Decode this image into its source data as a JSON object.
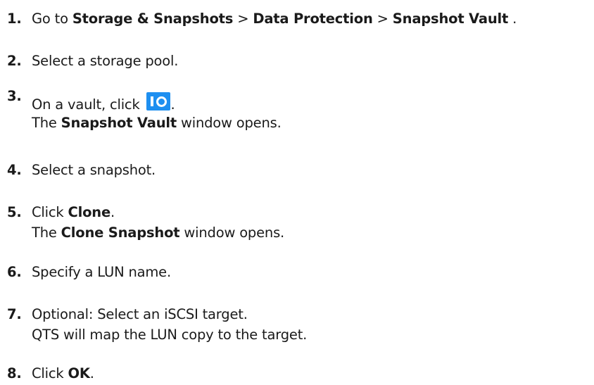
{
  "steps": [
    {
      "number": "1.",
      "parts": [
        "Go to ",
        "Storage & Snapshots",
        " > ",
        "Data Protection",
        " > ",
        "Snapshot Vault",
        " ."
      ]
    },
    {
      "number": "2.",
      "text": "Select a storage pool."
    },
    {
      "number": "3.",
      "line1_before": "On a vault, click ",
      "line1_after": ".",
      "icon": "snapshot-vault-icon",
      "line2_before": "The ",
      "line2_bold": "Snapshot Vault",
      "line2_after": " window opens."
    },
    {
      "number": "4.",
      "text": "Select a snapshot."
    },
    {
      "number": "5.",
      "line1_before": "Click ",
      "line1_bold": "Clone",
      "line1_after": ".",
      "line2_before": "The ",
      "line2_bold": "Clone Snapshot",
      "line2_after": " window opens."
    },
    {
      "number": "6.",
      "text": "Specify a LUN name."
    },
    {
      "number": "7.",
      "line1": "Optional: Select an iSCSI target.",
      "line2": "QTS will map the LUN copy to the target."
    },
    {
      "number": "8.",
      "line1_before": "Click ",
      "line1_bold": "OK",
      "line1_after": "."
    }
  ],
  "colors": {
    "text": "#1a1a1a",
    "icon_background": "#1e8ff0",
    "icon_glyph": "#ffffff"
  }
}
